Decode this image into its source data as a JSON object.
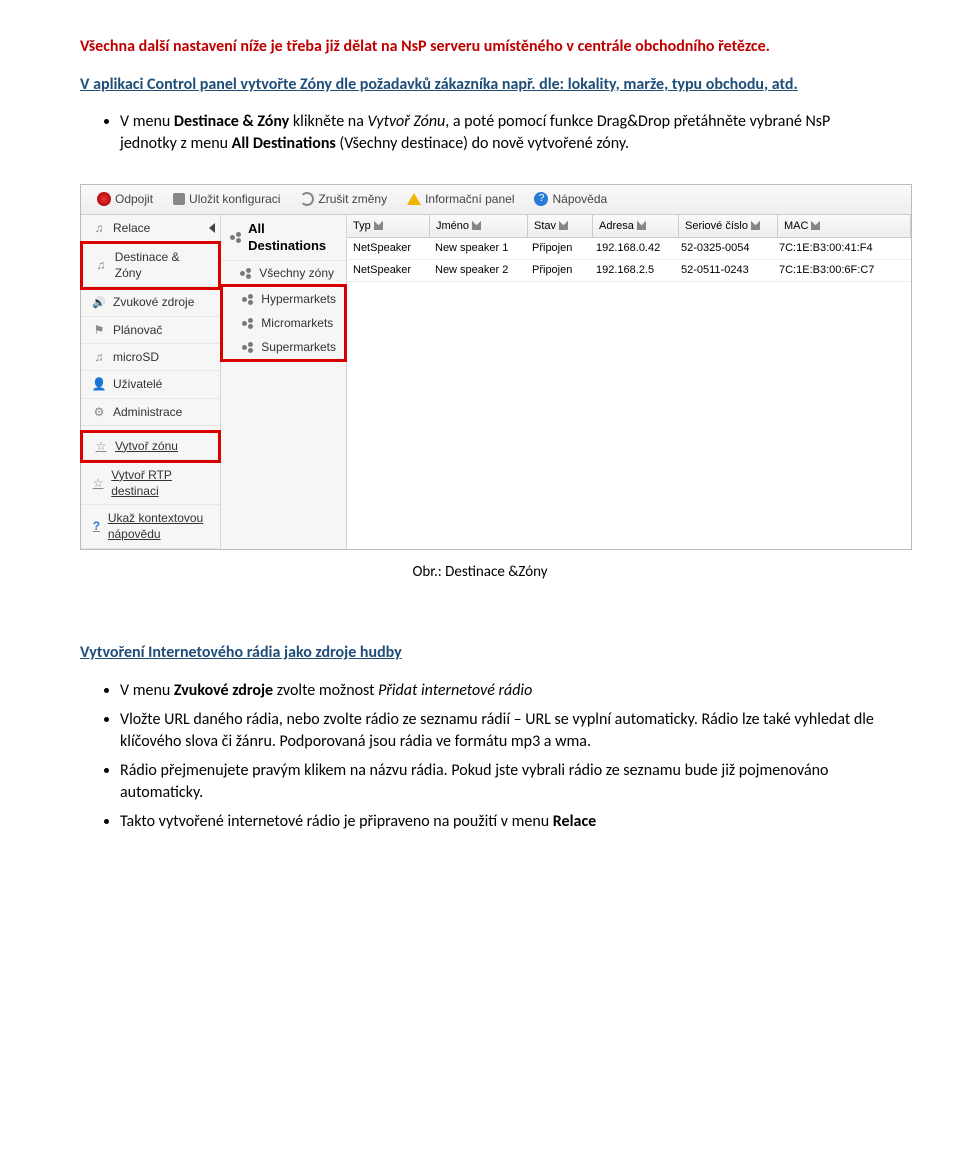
{
  "text": {
    "p1": "Všechna další nastavení níže je třeba již dělat na NsP serveru umístěného v centrále obchodního řetězce.",
    "p2_a": "V aplikaci Control panel vytvořte Zóny dle požadavků zákazníka např. dle: lokality, marže, typu obchodu, atd.",
    "bullet1_1": "V menu ",
    "bullet1_2": "Destinace & Zóny",
    "bullet1_3": " klikněte na ",
    "bullet1_4": "Vytvoř Zónu",
    "bullet1_5": ", a poté pomocí funkce Drag&Drop přetáhněte vybrané NsP jednotky z menu ",
    "bullet1_6": "All Destinations",
    "bullet1_7": " (Všechny destinace) do nově vytvořené zóny.",
    "caption1": "Obr.: Destinace &Zóny",
    "heading2": "Vytvoření Internetového rádia jako zdroje hudby",
    "b2_1a": "V menu ",
    "b2_1b": "Zvukové zdroje",
    "b2_1c": " zvolte možnost ",
    "b2_1d": "Přidat internetové rádio",
    "b2_2": "Vložte URL daného rádia, nebo zvolte rádio ze seznamu rádií – URL se vyplní automaticky. Rádio lze také vyhledat dle klíčového slova či žánru. Podporovaná jsou rádia ve formátu mp3 a wma.",
    "b2_3": "Rádio přejmenujete pravým klikem na názvu rádia. Pokud jste vybrali rádio ze seznamu bude již pojmenováno automaticky.",
    "b2_4a": "Takto vytvořené internetové rádio je připraveno na použití v menu ",
    "b2_4b": "Relace"
  },
  "app": {
    "toolbar": {
      "logout": "Odpojit",
      "save": "Uložit konfiguraci",
      "revert": "Zrušit změny",
      "info": "Informační panel",
      "help": "Nápověda"
    },
    "sidebar": {
      "sessions": "Relace",
      "destzones": "Destinace & Zóny",
      "sources": "Zvukové zdroje",
      "scheduler": "Plánovač",
      "microsd": "microSD",
      "users": "Uživatelé",
      "admin": "Administrace",
      "create_zone": "Vytvoř zónu",
      "create_rtp": "Vytvoř RTP destinaci",
      "ctx_help": "Ukaž kontextovou nápovědu"
    },
    "zones": {
      "title": "All Destinations",
      "all": "Všechny zóny",
      "z1": "Hypermarkets",
      "z2": "Micromarkets",
      "z3": "Supermarkets"
    },
    "grid": {
      "cols": {
        "typ": "Typ",
        "jm": "Jméno",
        "stav": "Stav",
        "adr": "Adresa",
        "ser": "Seriové číslo",
        "mac": "MAC"
      },
      "rows": [
        {
          "typ": "NetSpeaker",
          "jm": "New speaker 1",
          "stav": "Připojen",
          "adr": "192.168.0.42",
          "ser": "52-0325-0054",
          "mac": "7C:1E:B3:00:41:F4"
        },
        {
          "typ": "NetSpeaker",
          "jm": "New speaker 2",
          "stav": "Připojen",
          "adr": "192.168.2.5",
          "ser": "52-0511-0243",
          "mac": "7C:1E:B3:00:6F:C7"
        }
      ]
    }
  }
}
